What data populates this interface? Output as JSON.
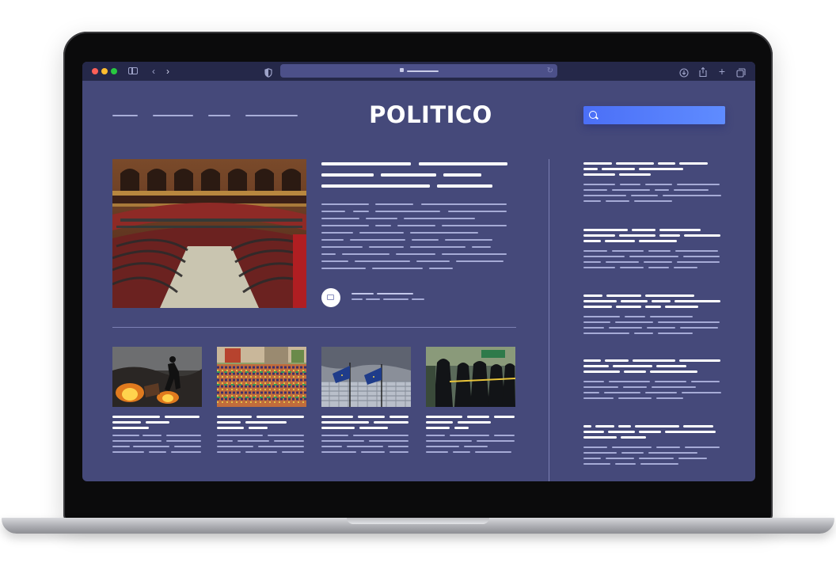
{
  "app": {
    "logo_text": "POLITICO"
  },
  "browser": {
    "traffic_lights": [
      "#fe5f57",
      "#febc2e",
      "#28c840"
    ],
    "icons": {
      "back": "chevron-left-icon",
      "forward": "chevron-right-icon",
      "shield": "shield-icon",
      "download": "download-icon",
      "share": "share-icon",
      "new_tab": "plus-icon",
      "tabs": "tabs-icon"
    }
  },
  "colors": {
    "page_background": "#45497a",
    "chrome_background": "#252849",
    "search_accent": "#4b6ff7",
    "placeholder_text_line": "#a6abd6"
  },
  "search": {
    "placeholder": ""
  },
  "images": {
    "hero": "parliament-chamber-image",
    "thumbs": [
      "protest-fire-image",
      "crowd-protest-image",
      "eu-flags-building-image",
      "riot-police-image"
    ]
  }
}
